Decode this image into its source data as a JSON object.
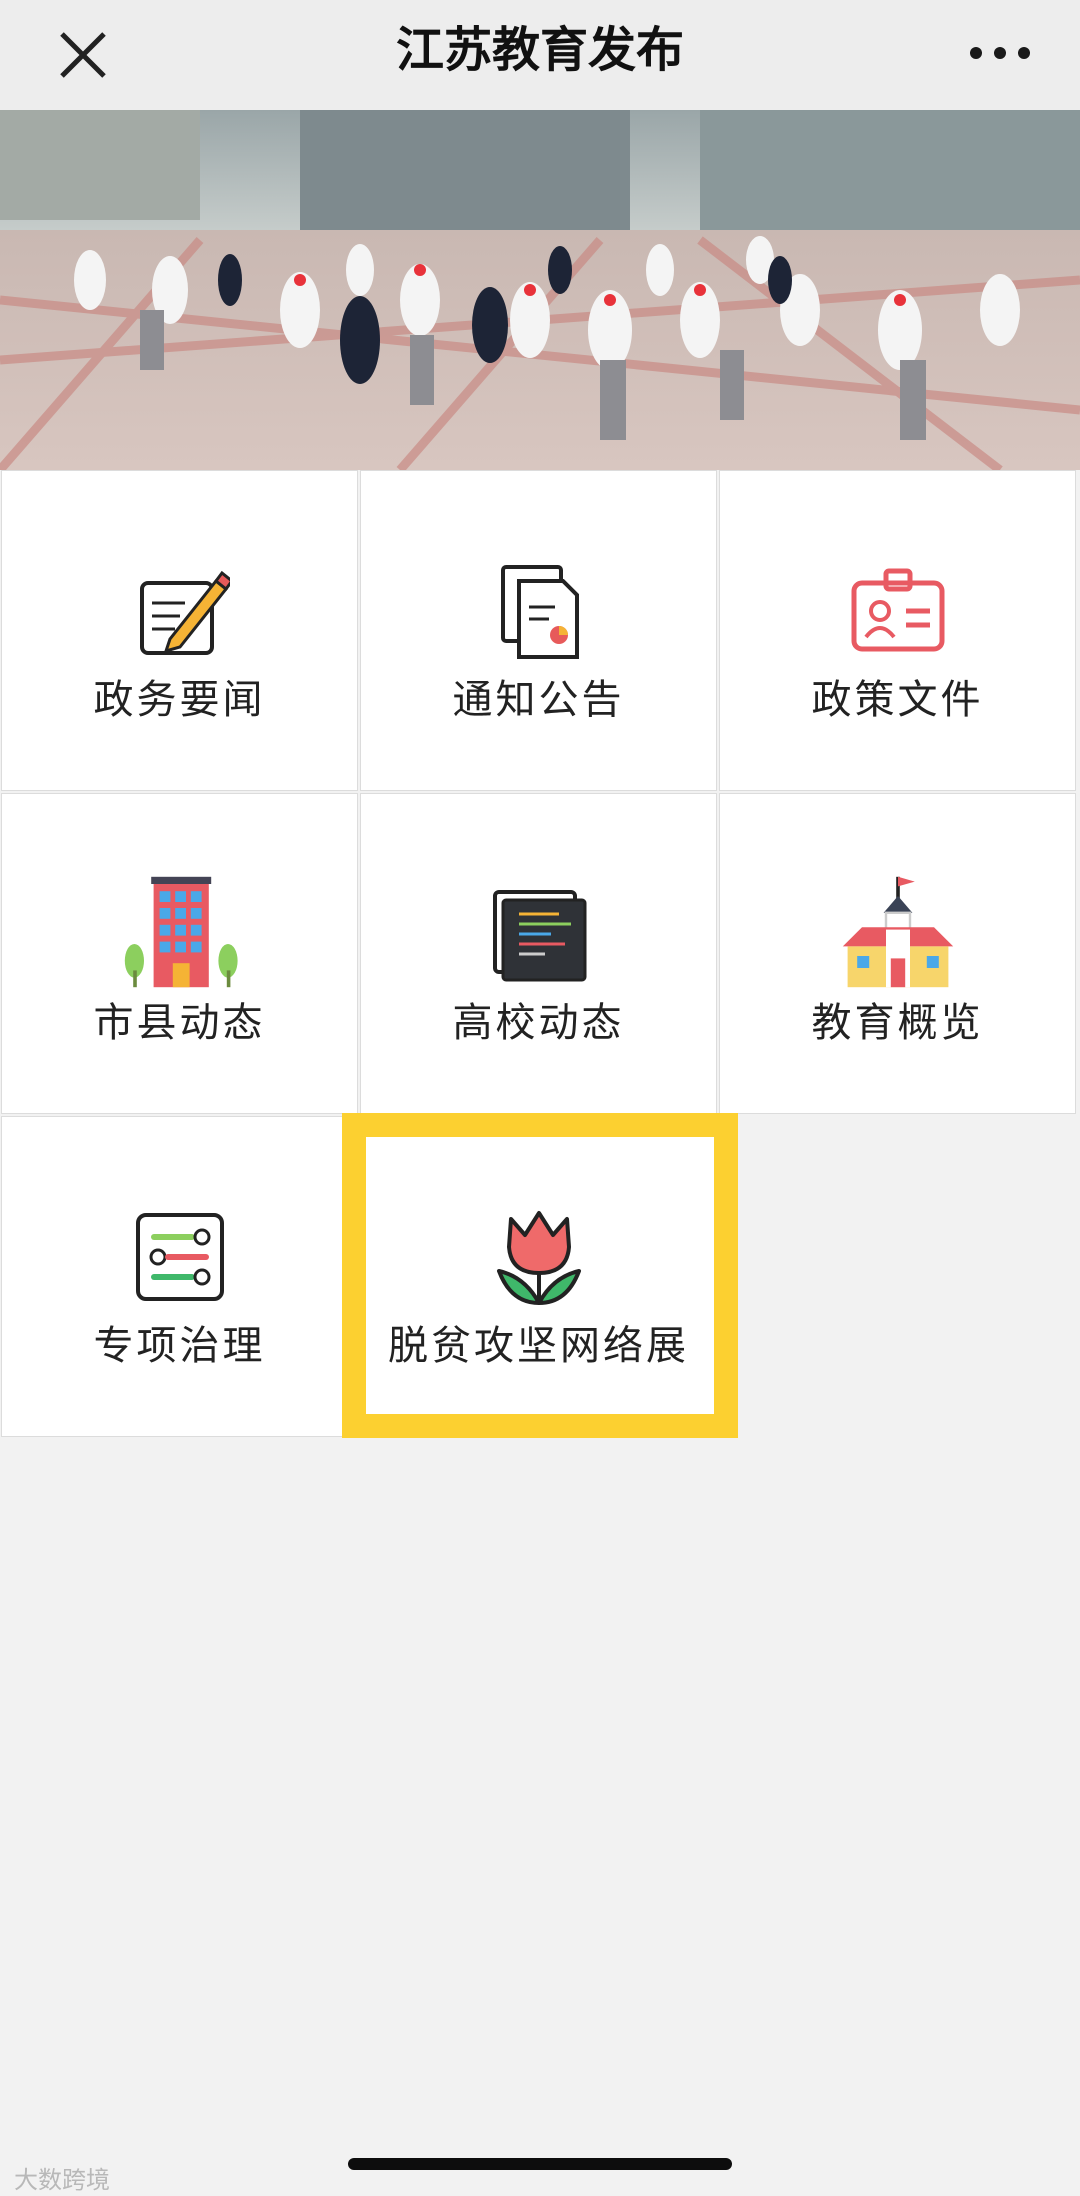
{
  "header": {
    "title": "江苏教育发布",
    "close_icon": "close-icon",
    "more_icon": "more-icon"
  },
  "banner": {
    "description_icon": "banner-photo"
  },
  "menu": {
    "items": [
      {
        "label": "政务要闻",
        "icon": "notepad-pencil-icon"
      },
      {
        "label": "通知公告",
        "icon": "document-icon"
      },
      {
        "label": "政策文件",
        "icon": "id-card-icon"
      },
      {
        "label": "市县动态",
        "icon": "building-icon"
      },
      {
        "label": "高校动态",
        "icon": "code-screen-icon"
      },
      {
        "label": "教育概览",
        "icon": "school-icon"
      },
      {
        "label": "专项治理",
        "icon": "checklist-icon"
      },
      {
        "label": "脱贫攻坚网络展",
        "icon": "tulip-icon"
      }
    ],
    "highlight_color": "#fcd030"
  },
  "watermark": "大数跨境"
}
